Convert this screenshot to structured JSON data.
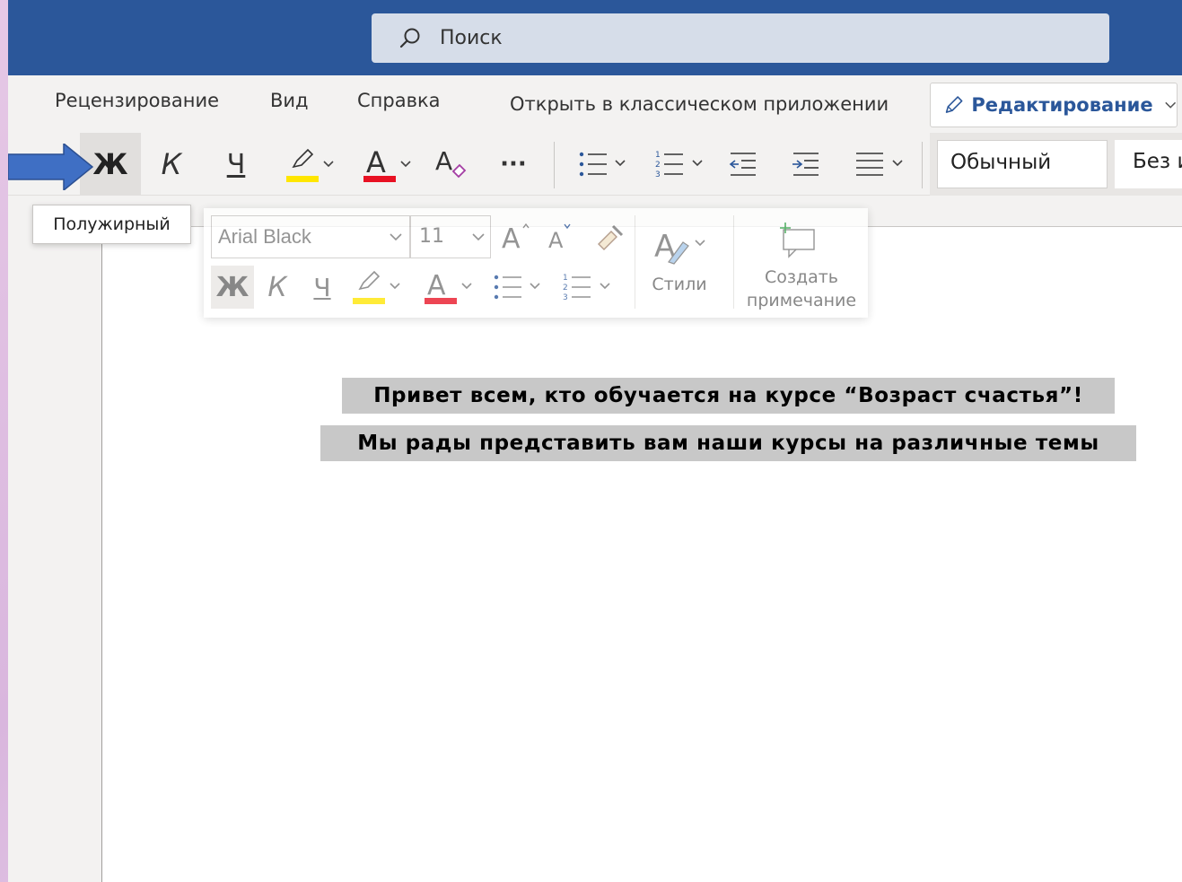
{
  "search": {
    "placeholder": "Поиск"
  },
  "ribbon_tabs": [
    {
      "label": "Рецензирование"
    },
    {
      "label": "Вид"
    },
    {
      "label": "Справка"
    },
    {
      "label": "Открыть в классическом приложении"
    }
  ],
  "mode_button": {
    "label": "Редактирование"
  },
  "toolbar": {
    "bold": "Ж",
    "italic": "К",
    "underline": "Ч",
    "font_color": "А",
    "more": "···",
    "style_current": "Обычный",
    "style_next": "Без интервала"
  },
  "tooltip": {
    "text": "Полужирный"
  },
  "mini_toolbar": {
    "font_name": "Arial Black",
    "font_size": "11",
    "bold": "Ж",
    "italic": "К",
    "underline": "Ч",
    "font_color": "А",
    "styles_label": "Стили",
    "comment_label_1": "Создать",
    "comment_label_2": "примечание"
  },
  "document": {
    "line1": "Привет всем, кто обучается на курсе “Возраст счастья”!",
    "line2": "Мы рады представить вам наши курсы на различные темы"
  },
  "colors": {
    "title_bar": "#2b579a",
    "highlight_yellow": "#ffe600",
    "font_red": "#e81123",
    "arrow_blue": "#3f6fc4",
    "text_highlight_gray": "#c8c8c8"
  }
}
